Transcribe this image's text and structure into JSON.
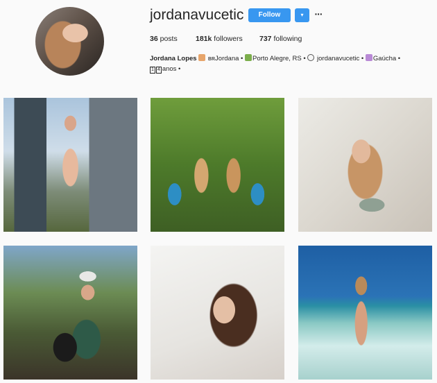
{
  "profile": {
    "username": "jordanavucetic",
    "follow_label": "Follow",
    "dropdown_glyph": "▾",
    "more_glyph": "···",
    "stats": {
      "posts_count": "36",
      "posts_label": " posts",
      "followers_count": "181k",
      "followers_label": " followers",
      "following_count": "737",
      "following_label": " following"
    },
    "bio": {
      "name": "Jordana Lopes",
      "seg1": " ʙʀJordana • ",
      "seg2": "Porto Alegre, RS • ",
      "seg3": " jordanavucetic • ",
      "seg4": "Gaúcha •",
      "k1": "1",
      "k2": "4",
      "seg5": "anos •"
    }
  },
  "colors": {
    "accent": "#3897f0",
    "background": "#fafafa",
    "text": "#262626"
  },
  "icons": {
    "emoji1": "heart-hands-emoji",
    "emoji2": "house-emoji",
    "emoji3": "at-sign-icon",
    "emoji4": "person-emoji"
  }
}
